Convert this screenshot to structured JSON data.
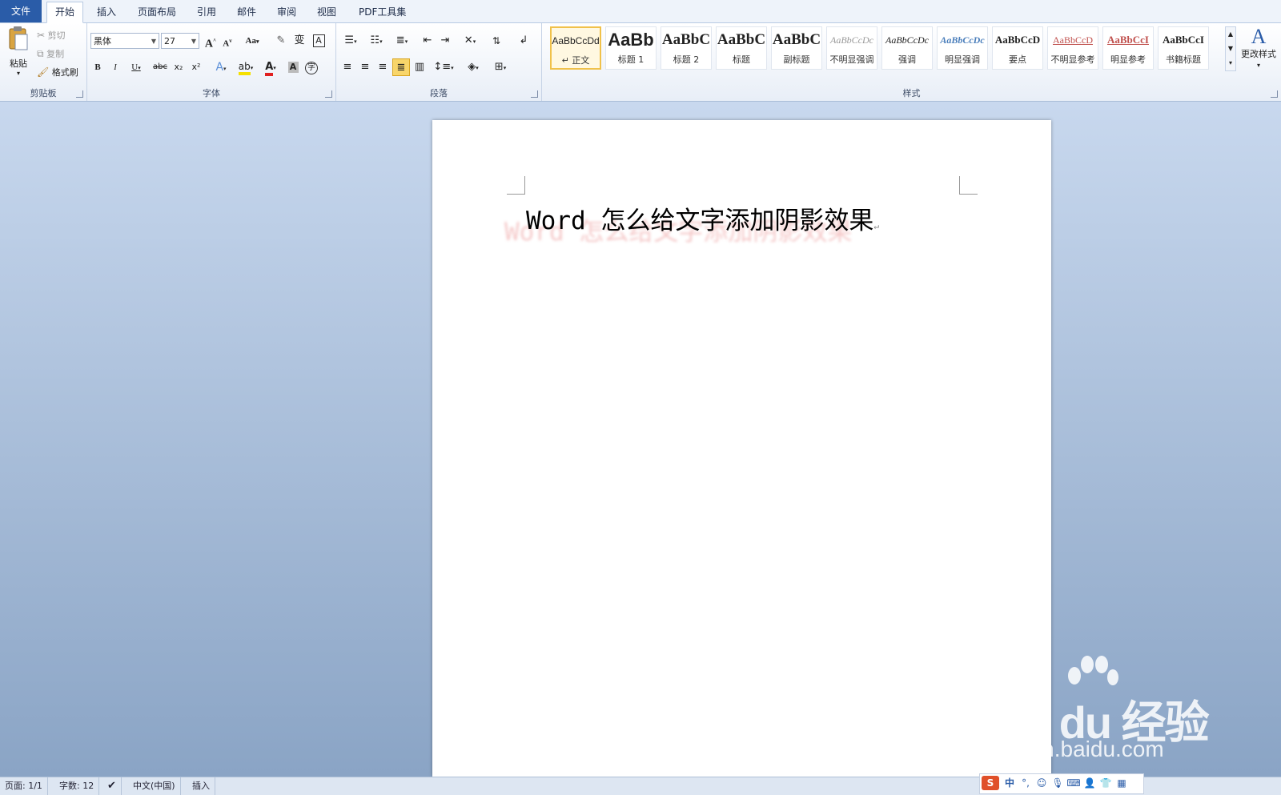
{
  "tabs": [
    {
      "label": "文件"
    },
    {
      "label": "开始"
    },
    {
      "label": "插入"
    },
    {
      "label": "页面布局"
    },
    {
      "label": "引用"
    },
    {
      "label": "邮件"
    },
    {
      "label": "审阅"
    },
    {
      "label": "视图"
    },
    {
      "label": "PDF工具集"
    }
  ],
  "clipboard": {
    "group_label": "剪贴板",
    "paste": "粘贴",
    "cut": "剪切",
    "copy": "复制",
    "format_painter": "格式刷"
  },
  "font": {
    "group_label": "字体",
    "font_name": "黑体",
    "font_size": "27",
    "bold": "B",
    "italic": "I",
    "underline": "U",
    "strike": "abc",
    "subscript": "x₂",
    "superscript": "x²",
    "grow": "A",
    "shrink": "A",
    "case": "Aa"
  },
  "paragraph": {
    "group_label": "段落"
  },
  "styles": {
    "group_label": "样式",
    "change_styles": "更改样式",
    "items": [
      {
        "sample": "AaBbCcDd",
        "name": "↵ 正文"
      },
      {
        "sample": "AaBb",
        "name": "标题 1"
      },
      {
        "sample": "AaBbC",
        "name": "标题 2"
      },
      {
        "sample": "AaBbC",
        "name": "标题"
      },
      {
        "sample": "AaBbC",
        "name": "副标题"
      },
      {
        "sample": "AaBbCcDc",
        "name": "不明显强调"
      },
      {
        "sample": "AaBbCcDc",
        "name": "强调"
      },
      {
        "sample": "AaBbCcDc",
        "name": "明显强调"
      },
      {
        "sample": "AaBbCcD",
        "name": "要点"
      },
      {
        "sample": "AaBbCcD",
        "name": "不明显参考"
      },
      {
        "sample": "AaBbCcI",
        "name": "明显参考"
      },
      {
        "sample": "AaBbCcI",
        "name": "书籍标题"
      }
    ]
  },
  "document": {
    "title": "Word 怎么给文字添加阴影效果",
    "para_mark": "↵"
  },
  "statusbar": {
    "page": "页面: 1/1",
    "words": "字数: 12",
    "language": "中文(中国)",
    "mode": "插入"
  },
  "ime": {
    "logo": "S",
    "lang": "中",
    "punct": "°,"
  },
  "watermark": {
    "logo": "Bai du 经验",
    "url": "jingyan.baidu.com"
  },
  "colors": {
    "file_tab": "#2a5ca8",
    "highlight": "#f5e000",
    "font_color": "#e02020",
    "active_style_border": "#f0c14a"
  }
}
